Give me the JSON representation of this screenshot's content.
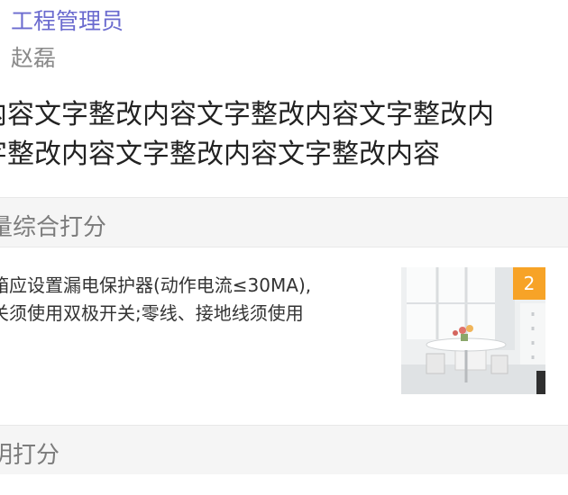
{
  "header": {
    "role": "工程管理员",
    "name": "赵磊"
  },
  "rectification": {
    "lines": [
      "内容文字整改内容文字整改内容文字整改内",
      "字整改内容文字整改内容文字整改内容"
    ]
  },
  "sections": {
    "quality_score": "量综合打分",
    "civilized_score": "明打分"
  },
  "item": {
    "lines": [
      "箱应设置漏电保护器(动作电流≤30MA),",
      "关须使用双极开关;零线、接地线须使用"
    ],
    "photo_count": "2"
  },
  "colors": {
    "role": "#6b6bcf",
    "badge": "#f7a327",
    "section_bg": "#f5f5f5"
  }
}
